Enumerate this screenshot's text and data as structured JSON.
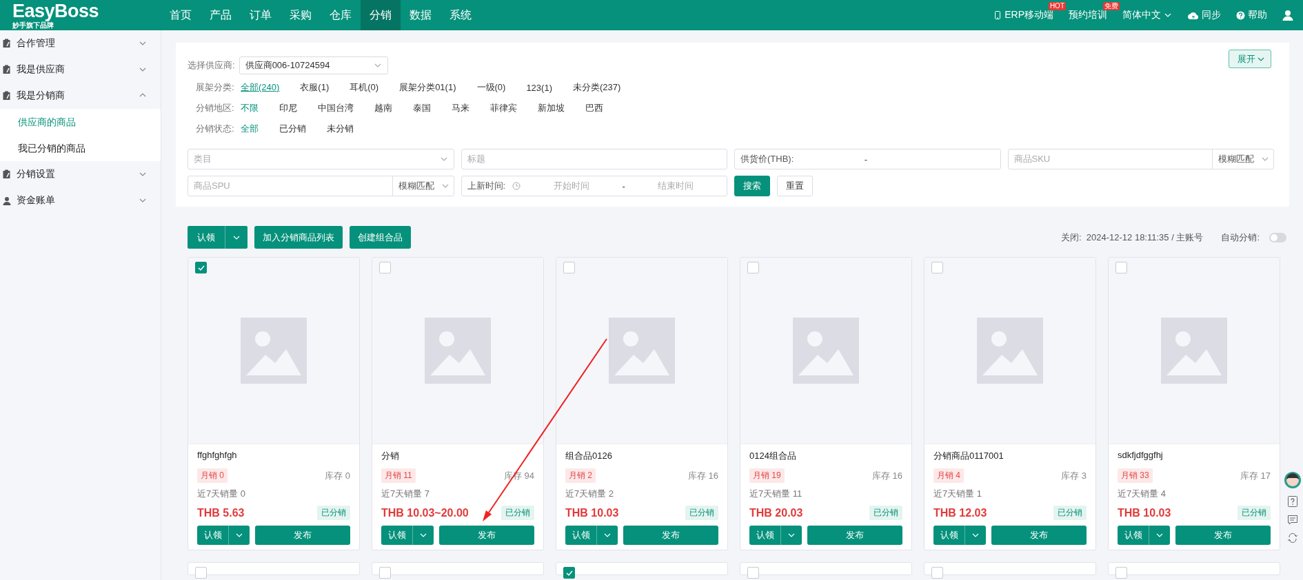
{
  "topbar": {
    "logo": "EasyBoss",
    "logo_sub": "妙手旗下品牌",
    "nav": [
      {
        "label": "首页",
        "selected": false
      },
      {
        "label": "产品",
        "selected": false
      },
      {
        "label": "订单",
        "selected": false
      },
      {
        "label": "采购",
        "selected": false
      },
      {
        "label": "仓库",
        "selected": false
      },
      {
        "label": "分销",
        "selected": true
      },
      {
        "label": "数据",
        "selected": false
      },
      {
        "label": "系统",
        "selected": false
      }
    ],
    "right": [
      {
        "kind": "mobile",
        "label": "ERP移动端",
        "badge": "HOT"
      },
      {
        "kind": "text",
        "label": "预约培训",
        "badge": "免费"
      },
      {
        "kind": "dropdown",
        "label": "简体中文"
      },
      {
        "kind": "sync",
        "label": "同步"
      },
      {
        "kind": "help",
        "label": "帮助"
      },
      {
        "kind": "user"
      }
    ]
  },
  "sidebar": {
    "items": [
      {
        "kind": "clipboard",
        "label": "合作管理",
        "expanded": false
      },
      {
        "kind": "clipboard",
        "label": "我是供应商",
        "expanded": false
      },
      {
        "kind": "clipboard",
        "label": "我是分销商",
        "expanded": true,
        "children": [
          {
            "label": "供应商的商品",
            "selected": true
          },
          {
            "label": "我已分销的商品",
            "selected": false
          }
        ]
      },
      {
        "kind": "clipboard",
        "label": "分销设置",
        "expanded": false
      },
      {
        "kind": "person",
        "label": "资金账单",
        "expanded": false
      }
    ]
  },
  "filters": {
    "supplier": {
      "label": "选择供应商:",
      "value": "供应商006-10724594"
    },
    "expand_button": "展开",
    "rows": [
      {
        "label": "展架分类:",
        "options": [
          {
            "label": "全部(240)",
            "selected": true
          },
          {
            "label": "衣服(1)",
            "selected": false
          },
          {
            "label": "耳机(0)",
            "selected": false
          },
          {
            "label": "展架分类01(1)",
            "selected": false
          },
          {
            "label": "一级(0)",
            "selected": false
          },
          {
            "label": "123(1)",
            "selected": false
          },
          {
            "label": "未分类(237)",
            "selected": false
          }
        ]
      },
      {
        "label": "分销地区:",
        "options": [
          {
            "label": "不限",
            "selected": true
          },
          {
            "label": "印尼",
            "selected": false
          },
          {
            "label": "中国台湾",
            "selected": false
          },
          {
            "label": "越南",
            "selected": false
          },
          {
            "label": "泰国",
            "selected": false
          },
          {
            "label": "马来",
            "selected": false
          },
          {
            "label": "菲律宾",
            "selected": false
          },
          {
            "label": "新加坡",
            "selected": false
          },
          {
            "label": "巴西",
            "selected": false
          }
        ]
      },
      {
        "label": "分销状态:",
        "options": [
          {
            "label": "全部",
            "selected": true
          },
          {
            "label": "已分销",
            "selected": false
          },
          {
            "label": "未分销",
            "selected": false
          }
        ]
      }
    ],
    "fields": [
      {
        "kind": "select",
        "placeholder": "类目"
      },
      {
        "kind": "text",
        "placeholder": "标题"
      },
      {
        "kind": "range",
        "label": "供货价(THB):",
        "separator": "-"
      },
      {
        "kind": "match",
        "placeholder": "商品SKU",
        "match": "模糊匹配"
      },
      {
        "kind": "match",
        "placeholder": "商品SPU",
        "match": "模糊匹配"
      },
      {
        "kind": "daterange",
        "label": "上新时间:",
        "start": "开始时间",
        "separator": "-",
        "end": "结束时间"
      },
      {
        "kind": "primary",
        "label": "搜索"
      },
      {
        "kind": "plain",
        "label": "重置"
      }
    ]
  },
  "toolbar": {
    "claim": "认领",
    "add": "加入分销商品列表",
    "combo": "创建组合品",
    "info": "关闭:  2024-12-12 18:11:35 / 主账号",
    "auto_label": "自动分销:",
    "auto_on": false
  },
  "cards": [
    {
      "selected": true,
      "name": "ffghfghfgh",
      "monthly": "月销 0",
      "stock": "库存 0",
      "week": "近7天销量 0",
      "price": "THB 5.63",
      "status": "已分销",
      "claim": "认领",
      "publish": "发布"
    },
    {
      "selected": false,
      "name": "分销",
      "monthly": "月销 11",
      "stock": "库存 94",
      "week": "近7天销量 7",
      "price": "THB 10.03~20.00",
      "status": "已分销",
      "claim": "认领",
      "publish": "发布"
    },
    {
      "selected": false,
      "name": "组合品0126",
      "monthly": "月销 2",
      "stock": "库存 16",
      "week": "近7天销量 2",
      "price": "THB 10.03",
      "status": "已分销",
      "claim": "认领",
      "publish": "发布"
    },
    {
      "selected": false,
      "name": "0124组合品",
      "monthly": "月销 19",
      "stock": "库存 16",
      "week": "近7天销量 11",
      "price": "THB 20.03",
      "status": "已分销",
      "claim": "认领",
      "publish": "发布"
    },
    {
      "selected": false,
      "name": "分销商品0117001",
      "monthly": "月销 4",
      "stock": "库存 3",
      "week": "近7天销量 1",
      "price": "THB 12.03",
      "status": "已分销",
      "claim": "认领",
      "publish": "发布"
    },
    {
      "selected": false,
      "name": "sdkfjdfggfhj",
      "monthly": "月销 33",
      "stock": "库存 17",
      "week": "近7天销量 4",
      "price": "THB 10.03",
      "status": "已分销",
      "claim": "认领",
      "publish": "发布"
    }
  ],
  "more_cards": [
    {
      "selected": false
    },
    {
      "selected": false
    },
    {
      "selected": true
    },
    {
      "selected": false
    },
    {
      "selected": false
    },
    {
      "selected": false
    }
  ]
}
